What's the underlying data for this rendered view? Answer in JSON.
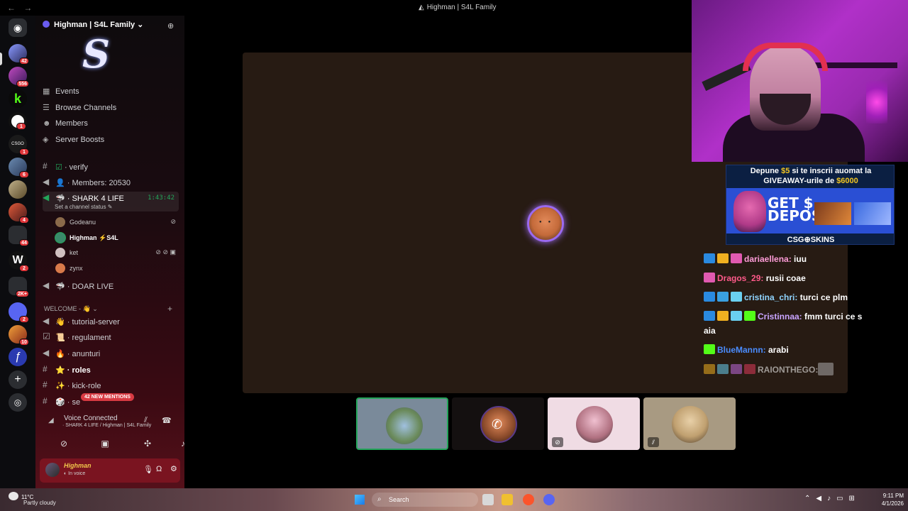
{
  "window": {
    "nav": "← →",
    "title": "Highman | S4L Family"
  },
  "server": {
    "name": "Highman | S4L Family ⌄"
  },
  "menu": [
    {
      "icon": "calendar-icon",
      "label": "Events"
    },
    {
      "icon": "browse-icon",
      "label": "Browse Channels"
    },
    {
      "icon": "members-icon",
      "label": "Members"
    },
    {
      "icon": "boost-icon",
      "label": "Server Boosts"
    }
  ],
  "channels": {
    "verify": "· verify",
    "members": "· Members: 20530",
    "shark": "· SHARK 4 LIFE",
    "shark_timer": "1:43:42",
    "shark_status": "Set a channel status ✎",
    "voice_users": [
      "Godeanu",
      "Highman ⚡S4L",
      "ket",
      "zynx"
    ],
    "doar_live": "· DOAR LIVE",
    "welcome_cat": "WELCOME - 👋 ⌄",
    "tutorial": "· tutorial-server",
    "regulament": "· regulament",
    "anunturi": "· anunturi",
    "roles": "· roles",
    "kick": "· kick-role",
    "se": "· se"
  },
  "mentions": "42 NEW MENTIONS",
  "guild_badges": [
    "42",
    "556",
    "1",
    "1",
    "6",
    "4",
    "44",
    "2",
    "2K+",
    "2",
    "10"
  ],
  "voice": {
    "status": "Voice Connected",
    "location": "· SHARK 4 LIFE / Highman | S4L Family"
  },
  "user": {
    "name": "Highman",
    "status": "◐ In voice"
  },
  "ad": {
    "line1_pre": "Depune ",
    "line1_amt": "$5",
    "line1_post": " si te inscrii auomat la",
    "line2_pre": "GIVEAWAY-urile de ",
    "line2_amt": "$6000",
    "get": "GET $\nDEPOS",
    "logo": "CSG⊕SKINS"
  },
  "chat": [
    {
      "user": "dariaellena:",
      "color": "#ff9cd8",
      "text": " iuu"
    },
    {
      "user": "Dragos_29:",
      "color": "#ff5a8a",
      "text": " rusii coae"
    },
    {
      "user": "cristina_chri:",
      "color": "#8fd4ff",
      "text": " turci ce plm"
    },
    {
      "user": "Cristinnaa:",
      "color": "#c9a4ff",
      "text": " fmm turci ce s"
    },
    {
      "user": "",
      "color": "#ffffff",
      "text": "aia"
    },
    {
      "user": "BlueMannn:",
      "color": "#4a8cff",
      "text": " arabi"
    },
    {
      "user": "RAIONTHEGO:",
      "color": "#ffffff",
      "text": ""
    }
  ],
  "taskbar": {
    "temp": "11°C",
    "weather": "Partly cloudy",
    "search": "Search",
    "time": "9:11 PM",
    "date": "4/1/2026"
  },
  "colors": {
    "accent": "#9b6af0",
    "connected": "#23a55a",
    "userpanel": "#7a1420"
  }
}
